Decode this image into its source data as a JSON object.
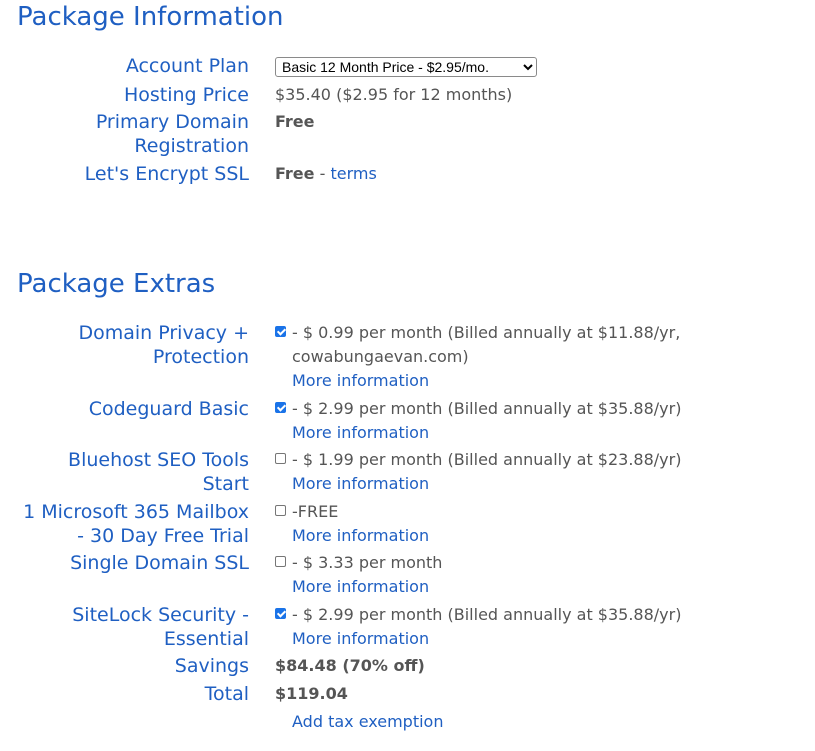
{
  "package_info": {
    "title": "Package Information",
    "account_plan_label": "Account Plan",
    "account_plan_selected": "Basic 12 Month Price - $2.95/mo.",
    "hosting_price_label": "Hosting Price",
    "hosting_price_value": "$35.40  ($2.95 for 12 months)",
    "domain_reg_label_1": "Primary Domain",
    "domain_reg_label_2": "Registration",
    "domain_reg_value": "Free",
    "ssl_label": "Let's Encrypt SSL",
    "ssl_value": "Free",
    "ssl_sep": " - ",
    "ssl_terms": "terms"
  },
  "package_extras": {
    "title": "Package Extras",
    "more_info": "More information",
    "items": [
      {
        "label_1": "Domain Privacy +",
        "label_2": "Protection",
        "checked": true,
        "text_1": "- $ 0.99 per month (Billed annually at $11.88/yr,",
        "text_2": "cowabungaevan.com)"
      },
      {
        "label_1": "Codeguard Basic",
        "checked": true,
        "text_1": "- $ 2.99 per month (Billed annually at $35.88/yr)"
      },
      {
        "label_1": "Bluehost SEO Tools",
        "label_2": "Start",
        "checked": false,
        "text_1": "- $ 1.99 per month (Billed annually at $23.88/yr)"
      },
      {
        "label_1": "1 Microsoft 365 Mailbox",
        "label_2": "- 30 Day Free Trial",
        "checked": false,
        "text_1": "-FREE"
      },
      {
        "label_1": "Single Domain SSL",
        "checked": false,
        "text_1": "- $ 3.33 per month"
      },
      {
        "label_1": "SiteLock Security -",
        "label_2": "Essential",
        "checked": true,
        "text_1": "- $ 2.99 per month (Billed annually at $35.88/yr)"
      }
    ],
    "savings_label": "Savings",
    "savings_value": "$84.48 (70% off)",
    "total_label": "Total",
    "total_value": "$119.04",
    "tax_exemption": "Add tax exemption"
  }
}
